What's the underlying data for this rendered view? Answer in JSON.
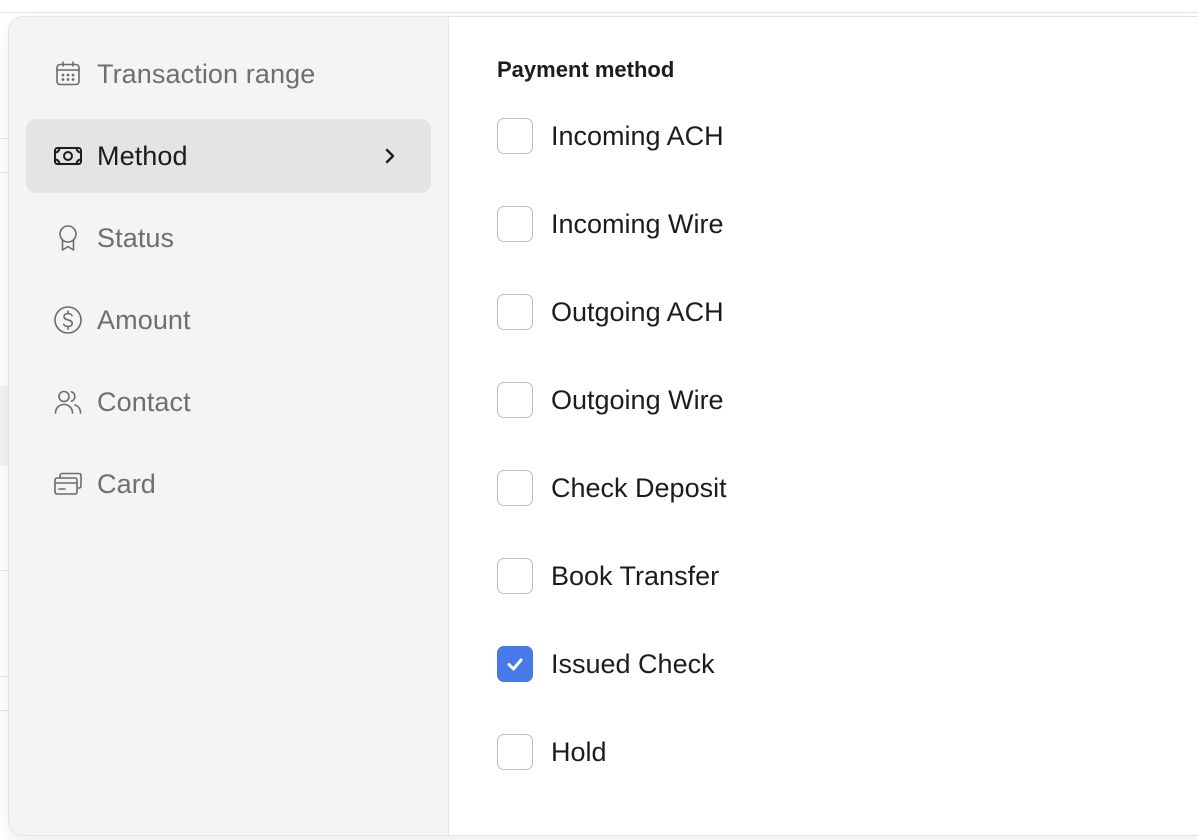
{
  "sidebar": {
    "items": [
      {
        "label": "Transaction range",
        "icon": "calendar-icon",
        "active": false
      },
      {
        "label": "Method",
        "icon": "banknote-icon",
        "active": true
      },
      {
        "label": "Status",
        "icon": "badge-icon",
        "active": false
      },
      {
        "label": "Amount",
        "icon": "dollar-circle-icon",
        "active": false
      },
      {
        "label": "Contact",
        "icon": "users-icon",
        "active": false
      },
      {
        "label": "Card",
        "icon": "cards-icon",
        "active": false
      }
    ]
  },
  "panel": {
    "title": "Payment method",
    "options": [
      {
        "label": "Incoming ACH",
        "checked": false
      },
      {
        "label": "Incoming Wire",
        "checked": false
      },
      {
        "label": "Outgoing ACH",
        "checked": false
      },
      {
        "label": "Outgoing Wire",
        "checked": false
      },
      {
        "label": "Check Deposit",
        "checked": false
      },
      {
        "label": "Book Transfer",
        "checked": false
      },
      {
        "label": "Issued Check",
        "checked": true
      },
      {
        "label": "Hold",
        "checked": false
      }
    ]
  },
  "colors": {
    "accent": "#4879e8",
    "sidebar_bg": "#f4f4f5",
    "active_bg": "#e4e4e7"
  }
}
